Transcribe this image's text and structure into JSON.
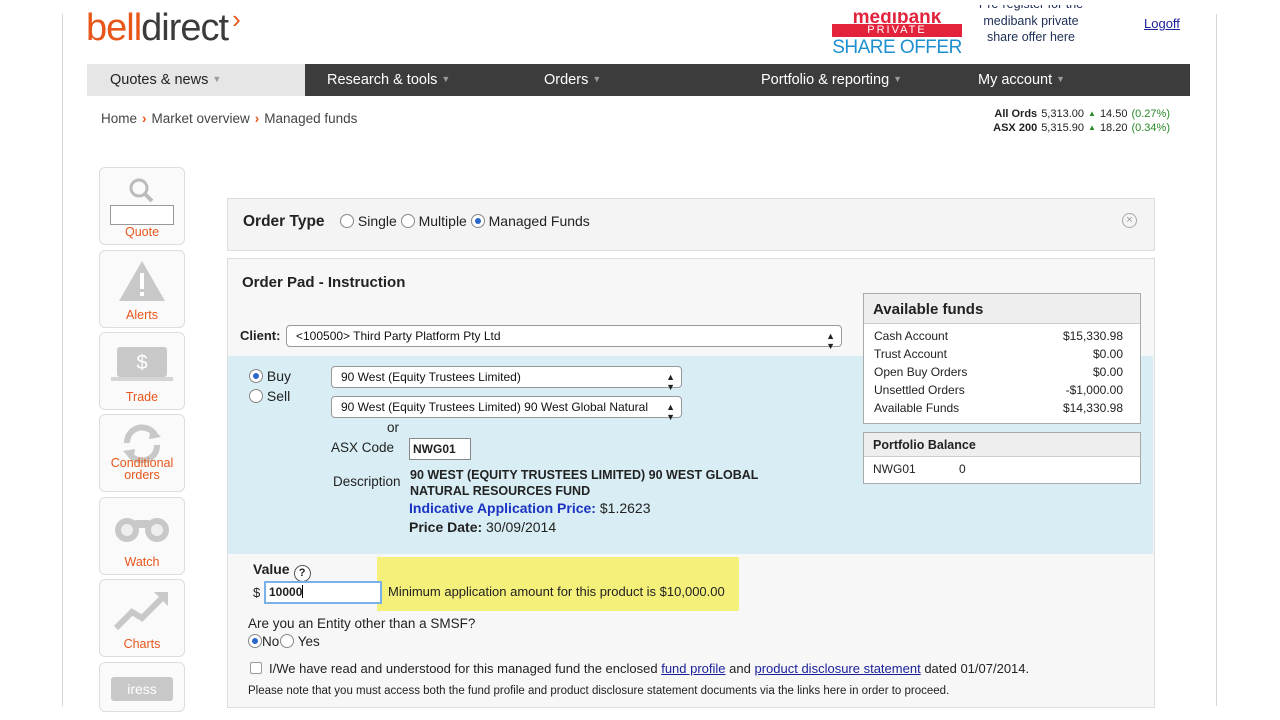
{
  "brand": {
    "part1": "bell",
    "part2": "direct",
    "chevron": "›"
  },
  "promo": {
    "line1": "medibank",
    "line2": "PRIVATE",
    "line3": "SHARE OFFER",
    "prereg_1": "Pre-register for the",
    "prereg_2": "medibank private",
    "prereg_3": "share offer here"
  },
  "logoff": "Logoff",
  "nav": [
    {
      "label": "Quotes & news",
      "active": true
    },
    {
      "label": "Research & tools",
      "active": false
    },
    {
      "label": "Orders",
      "active": false
    },
    {
      "label": "Portfolio & reporting",
      "active": false
    },
    {
      "label": "My account",
      "active": false
    }
  ],
  "breadcrumb": [
    "Home",
    "Market overview",
    "Managed funds"
  ],
  "ticker": [
    {
      "name": "All Ords",
      "value": "5,313.00",
      "change": "14.50",
      "pct": "(0.27%)"
    },
    {
      "name": "ASX 200",
      "value": "5,315.90",
      "change": "18.20",
      "pct": "(0.34%)"
    }
  ],
  "sidebar": {
    "quote": "Quote",
    "alerts": "Alerts",
    "trade": "Trade",
    "conditional_1": "Conditional",
    "conditional_2": "orders",
    "watch": "Watch",
    "charts": "Charts",
    "iress": "iress"
  },
  "order_type": {
    "title": "Order Type",
    "options": [
      "Single",
      "Multiple",
      "Managed Funds"
    ],
    "selected": "Managed Funds"
  },
  "order_pad": {
    "title": "Order Pad - Instruction",
    "client_label": "Client:",
    "client_value": "<100500> Third Party Platform Pty Ltd",
    "buy": "Buy",
    "sell": "Sell",
    "fund_manager": "90 West (Equity Trustees Limited)",
    "fund_product": "90 West (Equity Trustees Limited) 90 West Global Natural",
    "or": "or",
    "asx_label": "ASX Code",
    "asx_value": "NWG01",
    "desc_label": "Description",
    "desc_line1": "90 WEST (EQUITY TRUSTEES LIMITED) 90 WEST GLOBAL",
    "desc_line2": "NATURAL RESOURCES FUND",
    "price_label": "Indicative Application Price:",
    "price_value": "$1.2623",
    "date_label": "Price Date:",
    "date_value": "30/09/2014",
    "value_label": "Value",
    "help": "?",
    "dollar": "$",
    "value": "10000",
    "min_msg": "Minimum application amount for this product is $10,000.00",
    "entity_q": "Are you an Entity other than a SMSF?",
    "no": "No",
    "yes": "Yes",
    "agree_1": "I/We have read and understood for this managed fund the enclosed",
    "fund_profile": "fund profile",
    "and": "and",
    "pds": "product disclosure statement",
    "agree_2": "dated 01/07/2014.",
    "note": "Please note that you must access both the fund profile and product disclosure statement documents via the links here in order to proceed."
  },
  "available_funds": {
    "title": "Available funds",
    "rows": [
      {
        "label": "Cash Account",
        "value": "$15,330.98"
      },
      {
        "label": "Trust Account",
        "value": "$0.00"
      },
      {
        "label": "Open Buy Orders",
        "value": "$0.00"
      },
      {
        "label": "Unsettled Orders",
        "value": "-$1,000.00"
      },
      {
        "label": "Available Funds",
        "value": "$14,330.98"
      }
    ]
  },
  "portfolio_balance": {
    "title": "Portfolio Balance",
    "code": "NWG01",
    "qty": "0"
  }
}
